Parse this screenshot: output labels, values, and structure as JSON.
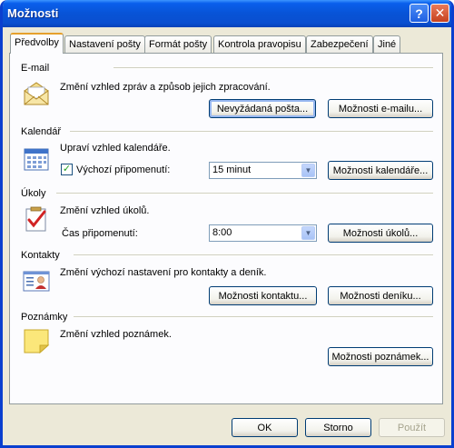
{
  "window": {
    "title": "Možnosti",
    "help_glyph": "?",
    "close_glyph": "✕"
  },
  "tabs": [
    {
      "label": "Předvolby",
      "active": true
    },
    {
      "label": "Nastavení pošty"
    },
    {
      "label": "Formát pošty"
    },
    {
      "label": "Kontrola pravopisu"
    },
    {
      "label": "Zabezpečení"
    },
    {
      "label": "Jiné"
    }
  ],
  "email": {
    "title": "E-mail",
    "description": "Změní vzhled zpráv a způsob jejich zpracování.",
    "junk_button": "Nevyžádaná pošta...",
    "options_button": "Možnosti e-mailu..."
  },
  "calendar": {
    "title": "Kalendář",
    "description": "Upraví vzhled kalendáře.",
    "reminder_label": "Výchozí připomenutí:",
    "reminder_checked": true,
    "reminder_value": "15 minut",
    "options_button": "Možnosti kalendáře..."
  },
  "tasks": {
    "title": "Úkoly",
    "description": "Změní vzhled úkolů.",
    "reminder_label": "Čas připomenutí:",
    "reminder_value": "8:00",
    "options_button": "Možnosti úkolů..."
  },
  "contacts": {
    "title": "Kontakty",
    "description": "Změní výchozí nastavení pro kontakty a deník.",
    "contact_button": "Možnosti kontaktu...",
    "journal_button": "Možnosti deníku..."
  },
  "notes": {
    "title": "Poznámky",
    "description": "Změní vzhled poznámek.",
    "options_button": "Možnosti poznámek..."
  },
  "footer": {
    "ok": "OK",
    "cancel": "Storno",
    "apply": "Použít"
  },
  "colors": {
    "titlebar": "#0853d6",
    "dialog_bg": "#ece9d8",
    "panel_bg": "#fcfcfe",
    "tab_highlight": "#e6a02c"
  }
}
